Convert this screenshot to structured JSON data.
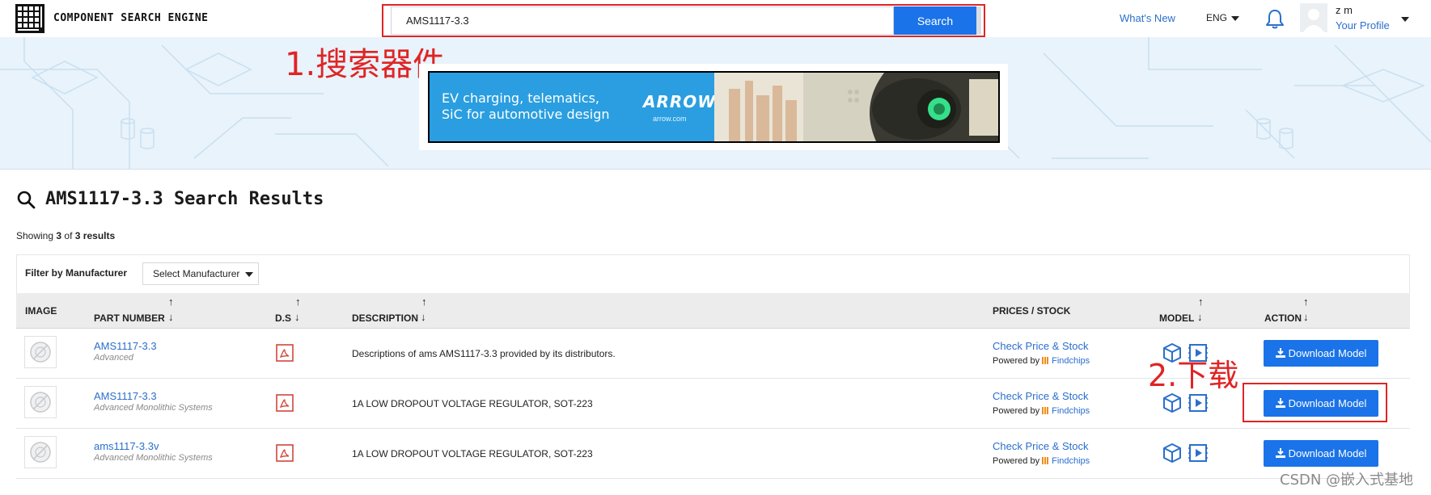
{
  "header": {
    "brand": "COMPONENT SEARCH ENGINE",
    "search_value": "AMS1117-3.3",
    "search_button": "Search",
    "whats_new": "What's New",
    "language": "ENG",
    "user_name": "z m",
    "profile_link": "Your Profile",
    "icons": {
      "logo": "grid-logo-icon",
      "bell": "bell-icon",
      "avatar": "avatar-icon"
    }
  },
  "annotations": {
    "step1": "1.搜索器件",
    "step2": "2.下载"
  },
  "ad_banner": {
    "text_line1": "EV charging, telematics,",
    "text_line2": "SiC for automotive design",
    "brand": "ARROW",
    "brand_sub": "arrow.com"
  },
  "results": {
    "title": "AMS1117-3.3 Search Results",
    "showing_prefix": "Showing",
    "showing_count": "3",
    "showing_of": "of",
    "showing_total": "3",
    "showing_suffix": "results",
    "filter_label": "Filter by Manufacturer",
    "filter_select": "Select Manufacturer",
    "columns": {
      "image": "IMAGE",
      "part_number": "PART NUMBER",
      "ds": "D.S",
      "description": "DESCRIPTION",
      "prices": "PRICES / STOCK",
      "model": "MODEL",
      "action": "ACTION"
    },
    "sort_up": "↑",
    "sort_down": "↓",
    "rows": [
      {
        "part_number": "AMS1117-3.3",
        "manufacturer": "Advanced",
        "description": "Descriptions of ams AMS1117-3.3 provided by its distributors.",
        "price_link": "Check Price & Stock",
        "powered_by": "Powered by",
        "findchips": "Findchips",
        "action": "Download Model"
      },
      {
        "part_number": "AMS1117-3.3",
        "manufacturer": "Advanced Monolithic Systems",
        "description": "1A LOW DROPOUT VOLTAGE REGULATOR, SOT-223",
        "price_link": "Check Price & Stock",
        "powered_by": "Powered by",
        "findchips": "Findchips",
        "action": "Download Model"
      },
      {
        "part_number": "ams1117-3.3v",
        "manufacturer": "Advanced Monolithic Systems",
        "description": "1A LOW DROPOUT VOLTAGE REGULATOR, SOT-223",
        "price_link": "Check Price & Stock",
        "powered_by": "Powered by",
        "findchips": "Findchips",
        "action": "Download Model"
      }
    ]
  },
  "watermark": "CSDN @嵌入式基地",
  "colors": {
    "accent": "#1a73e8",
    "link": "#2b6fcc",
    "annotation_red": "#e02424",
    "hero_bg": "#e8f3fb",
    "table_head_bg": "#ececec"
  }
}
